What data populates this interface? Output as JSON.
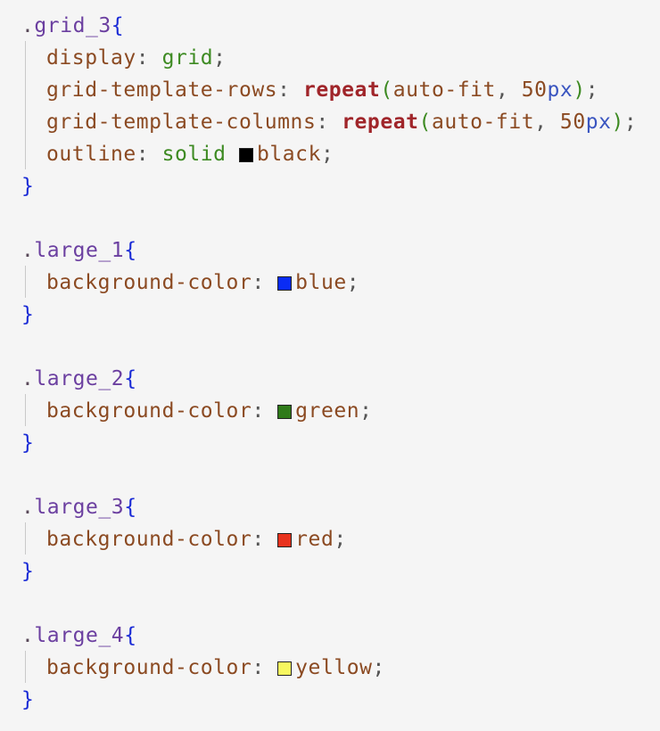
{
  "rules": [
    {
      "selector": "grid_3",
      "decls": [
        {
          "prop": "display",
          "value": "grid"
        },
        {
          "prop": "grid-template-rows",
          "fn": "repeat",
          "arg1": "auto-fit",
          "num": "50",
          "unit": "px"
        },
        {
          "prop": "grid-template-columns",
          "fn": "repeat",
          "arg1": "auto-fit",
          "num": "50",
          "unit": "px"
        },
        {
          "prop": "outline",
          "value": "solid",
          "swatch": "#000000",
          "color_name": "black"
        }
      ]
    },
    {
      "selector": "large_1",
      "decls": [
        {
          "prop": "background-color",
          "swatch": "#0a2cf5",
          "color_name": "blue"
        }
      ]
    },
    {
      "selector": "large_2",
      "decls": [
        {
          "prop": "background-color",
          "swatch": "#2f7a1a",
          "color_name": "green"
        }
      ]
    },
    {
      "selector": "large_3",
      "decls": [
        {
          "prop": "background-color",
          "swatch": "#e8321e",
          "color_name": "red"
        }
      ]
    },
    {
      "selector": "large_4",
      "decls": [
        {
          "prop": "background-color",
          "swatch": "#f7f760",
          "color_name": "yellow"
        }
      ]
    }
  ]
}
